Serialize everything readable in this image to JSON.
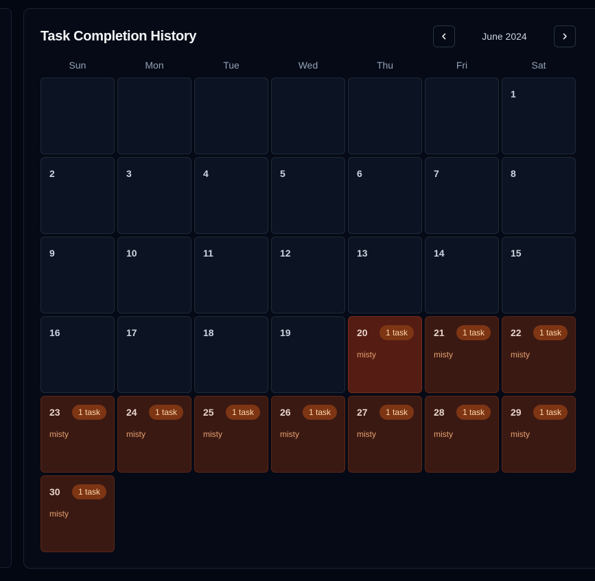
{
  "calendar": {
    "title": "Task Completion History",
    "month_label": "June 2024",
    "prev_icon": "chevron-left-icon",
    "next_icon": "chevron-right-icon",
    "weekdays": [
      "Sun",
      "Mon",
      "Tue",
      "Wed",
      "Thu",
      "Fri",
      "Sat"
    ],
    "first_weekday_index": 6,
    "days_in_month": 30,
    "highlighted_day": "20",
    "colors": {
      "completed_bg": "#3a1912",
      "highlighted_bg": "#541c12",
      "badge_bg": "#7d3514",
      "badge_text": "#fed7aa",
      "label_text": "#e6a070"
    },
    "completions": {
      "20": {
        "badge": "1 task",
        "label": "misty"
      },
      "21": {
        "badge": "1 task",
        "label": "misty"
      },
      "22": {
        "badge": "1 task",
        "label": "misty"
      },
      "23": {
        "badge": "1 task",
        "label": "misty"
      },
      "24": {
        "badge": "1 task",
        "label": "misty"
      },
      "25": {
        "badge": "1 task",
        "label": "misty"
      },
      "26": {
        "badge": "1 task",
        "label": "misty"
      },
      "27": {
        "badge": "1 task",
        "label": "misty"
      },
      "28": {
        "badge": "1 task",
        "label": "misty"
      },
      "29": {
        "badge": "1 task",
        "label": "misty"
      },
      "30": {
        "badge": "1 task",
        "label": "misty"
      }
    }
  }
}
